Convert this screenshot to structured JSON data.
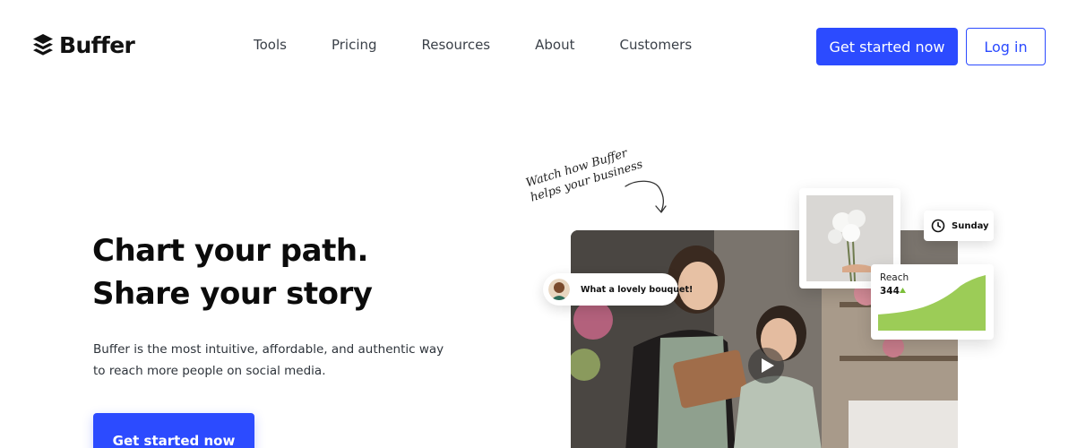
{
  "brand": {
    "name": "Buffer",
    "accent": "#2c4bff"
  },
  "nav": [
    {
      "label": "Tools"
    },
    {
      "label": "Pricing"
    },
    {
      "label": "Resources"
    },
    {
      "label": "About"
    },
    {
      "label": "Customers"
    }
  ],
  "header_actions": {
    "primary": "Get started now",
    "secondary": "Log in"
  },
  "hero": {
    "title_line1": "Chart your path.",
    "title_line2": "Share your story",
    "description": "Buffer is the most intuitive, affordable, and authentic way to reach more people on social media.",
    "cta": "Get started now"
  },
  "media": {
    "handwritten_line1": "Watch how Buffer",
    "handwritten_line2": "helps your business",
    "comment": "What a lovely bouquet!",
    "schedule_day": "Sunday",
    "reach_label": "Reach",
    "reach_value": "344",
    "icons": [
      "buffer-logo-icon",
      "play-icon",
      "clock-icon",
      "trend-up-icon",
      "arrow-icon"
    ],
    "reach_color": "#9ccc57"
  }
}
